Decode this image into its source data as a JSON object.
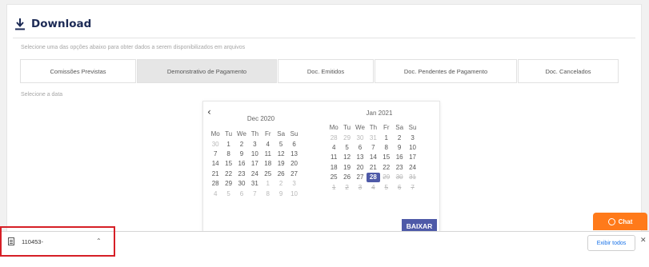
{
  "header": {
    "title": "Download",
    "icon": "download-icon"
  },
  "subtitle": "Selecione uma das opções abaixo para obter dados a serem disponibilizados em arquivos",
  "tabs": [
    {
      "label": "Comissões Previstas",
      "active": false
    },
    {
      "label": "Demonstrativo de Pagamento",
      "active": true
    },
    {
      "label": "Doc. Emitidos",
      "active": false
    },
    {
      "label": "Doc. Pendentes de Pagamento",
      "active": false
    },
    {
      "label": "Doc. Cancelados",
      "active": false
    }
  ],
  "date_label": "Selecione a data",
  "datepicker": {
    "prev_icon": "chevron-left-icon",
    "weekdays": [
      "Mo",
      "Tu",
      "We",
      "Th",
      "Fr",
      "Sa",
      "Su"
    ],
    "months": [
      {
        "title": "Dec 2020",
        "weeks": [
          [
            {
              "d": "30",
              "s": "muted"
            },
            {
              "d": "1"
            },
            {
              "d": "2"
            },
            {
              "d": "3"
            },
            {
              "d": "4"
            },
            {
              "d": "5"
            },
            {
              "d": "6"
            }
          ],
          [
            {
              "d": "7"
            },
            {
              "d": "8"
            },
            {
              "d": "9"
            },
            {
              "d": "10"
            },
            {
              "d": "11"
            },
            {
              "d": "12"
            },
            {
              "d": "13"
            }
          ],
          [
            {
              "d": "14"
            },
            {
              "d": "15"
            },
            {
              "d": "16"
            },
            {
              "d": "17"
            },
            {
              "d": "18"
            },
            {
              "d": "19"
            },
            {
              "d": "20"
            }
          ],
          [
            {
              "d": "21"
            },
            {
              "d": "22"
            },
            {
              "d": "23"
            },
            {
              "d": "24"
            },
            {
              "d": "25"
            },
            {
              "d": "26"
            },
            {
              "d": "27"
            }
          ],
          [
            {
              "d": "28"
            },
            {
              "d": "29"
            },
            {
              "d": "30"
            },
            {
              "d": "31"
            },
            {
              "d": "1",
              "s": "muted"
            },
            {
              "d": "2",
              "s": "muted"
            },
            {
              "d": "3",
              "s": "muted"
            }
          ],
          [
            {
              "d": "4",
              "s": "muted"
            },
            {
              "d": "5",
              "s": "muted"
            },
            {
              "d": "6",
              "s": "muted"
            },
            {
              "d": "7",
              "s": "muted"
            },
            {
              "d": "8",
              "s": "muted"
            },
            {
              "d": "9",
              "s": "muted"
            },
            {
              "d": "10",
              "s": "muted"
            }
          ]
        ]
      },
      {
        "title": "Jan 2021",
        "weeks": [
          [
            {
              "d": "28",
              "s": "muted"
            },
            {
              "d": "29",
              "s": "muted"
            },
            {
              "d": "30",
              "s": "muted"
            },
            {
              "d": "31",
              "s": "muted"
            },
            {
              "d": "1"
            },
            {
              "d": "2"
            },
            {
              "d": "3"
            }
          ],
          [
            {
              "d": "4"
            },
            {
              "d": "5"
            },
            {
              "d": "6"
            },
            {
              "d": "7"
            },
            {
              "d": "8"
            },
            {
              "d": "9"
            },
            {
              "d": "10"
            }
          ],
          [
            {
              "d": "11"
            },
            {
              "d": "12"
            },
            {
              "d": "13"
            },
            {
              "d": "14"
            },
            {
              "d": "15"
            },
            {
              "d": "16"
            },
            {
              "d": "17"
            }
          ],
          [
            {
              "d": "18"
            },
            {
              "d": "19"
            },
            {
              "d": "20"
            },
            {
              "d": "21"
            },
            {
              "d": "22"
            },
            {
              "d": "23"
            },
            {
              "d": "24"
            }
          ],
          [
            {
              "d": "25"
            },
            {
              "d": "26"
            },
            {
              "d": "27"
            },
            {
              "d": "28",
              "s": "selected"
            },
            {
              "d": "29",
              "s": "strike"
            },
            {
              "d": "30",
              "s": "strike"
            },
            {
              "d": "31",
              "s": "strike"
            }
          ],
          [
            {
              "d": "1",
              "s": "strike"
            },
            {
              "d": "2",
              "s": "strike"
            },
            {
              "d": "3",
              "s": "strike"
            },
            {
              "d": "4",
              "s": "strike"
            },
            {
              "d": "5",
              "s": "strike"
            },
            {
              "d": "6",
              "s": "strike"
            },
            {
              "d": "7",
              "s": "strike"
            }
          ]
        ]
      }
    ]
  },
  "baixar_label": "BAIXAR",
  "chat": {
    "label": "Chat",
    "icon": "chat-icon"
  },
  "download_bar": {
    "file_name": "110453-",
    "file_icon": "file-icon",
    "chevron_icon": "chevron-up-icon",
    "show_all_label": "Exibir todos",
    "close_icon": "close-icon"
  },
  "colors": {
    "accent": "#4e5aa8",
    "chat": "#ff7a1a",
    "highlight": "#d61f26",
    "title": "#1c2a55"
  }
}
